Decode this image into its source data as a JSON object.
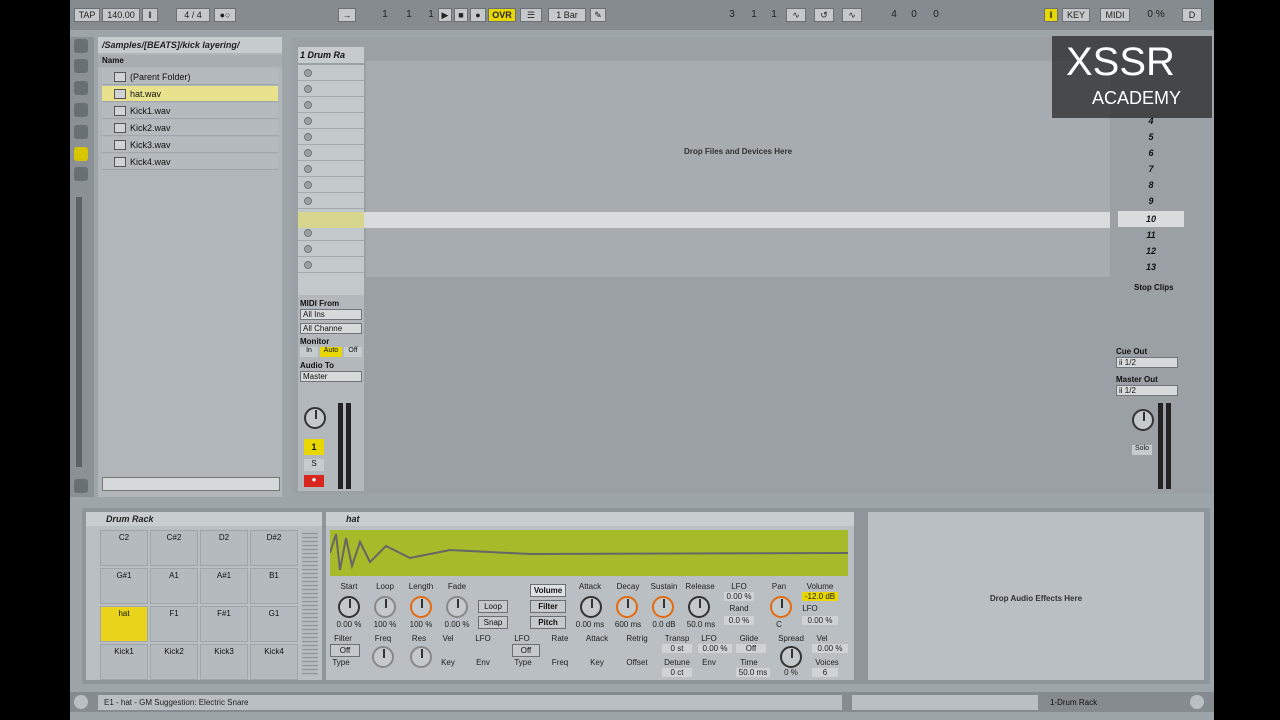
{
  "topbar": {
    "tap": "TAP",
    "tempo": "140.00",
    "signature": "4 / 4",
    "pos1": "1",
    "pos2": "1",
    "pos3": "1",
    "ovr": "OVR",
    "quant": "1 Bar",
    "loop1": "3",
    "loop2": "1",
    "loop3": "1",
    "len1": "4",
    "len2": "0",
    "len3": "0",
    "key": "KEY",
    "midi": "MIDI",
    "cpu": "0 %",
    "d": "D"
  },
  "browser": {
    "path": "/Samples/[BEATS]/kick layering/",
    "column": "Name",
    "items": [
      "(Parent Folder)",
      "hat.wav",
      "Kick1.wav",
      "Kick2.wav",
      "Kick3.wav",
      "Kick4.wav"
    ]
  },
  "session": {
    "track_title": "1 Drum Ra",
    "drop_text": "Drop Files and Devices Here",
    "scenes": [
      "4",
      "5",
      "6",
      "7",
      "8",
      "9",
      "10",
      "11",
      "12",
      "13"
    ],
    "stop_clips": "Stop Clips",
    "cue_out": "Cue Out",
    "cue_val": "ii 1/2",
    "master_out": "Master Out",
    "master_val": "ii 1/2",
    "solo": "Solo"
  },
  "mixer": {
    "midi_from": "MIDI From",
    "all_ins": "All Ins",
    "all_channels": "All Channe",
    "monitor": "Monitor",
    "mon_in": "In",
    "mon_auto": "Auto",
    "mon_off": "Off",
    "audio_to": "Audio To",
    "master": "Master",
    "track_num": "1",
    "s": "S"
  },
  "drum_rack": {
    "title": "Drum Rack",
    "pads": [
      [
        "C2",
        "C#2",
        "D2",
        "D#2"
      ],
      [
        "G#1",
        "A1",
        "A#1",
        "B1"
      ],
      [
        "hat",
        "F1",
        "F#1",
        "G1"
      ],
      [
        "Kick1",
        "Kick2",
        "Kick3",
        "Kick4"
      ]
    ]
  },
  "simpler": {
    "title": "hat",
    "top_labels": [
      "Start",
      "Loop",
      "Length",
      "Fade"
    ],
    "top_values": [
      "0.00 %",
      "100 %",
      "100 %",
      "0.00 %"
    ],
    "loop": "Loop",
    "snap": "Snap",
    "volume": "Volume",
    "filter": "Filter",
    "pitch": "Pitch",
    "env_labels": [
      "Attack",
      "Decay",
      "Sustain",
      "Release"
    ],
    "env_values": [
      "0.00 ms",
      "600 ms",
      "0.0 dB",
      "50.0 ms"
    ],
    "lfo": "LFO",
    "lfo_val": "0.00 %",
    "rand": "Rand",
    "rand_val": "0.0 %",
    "pan": "Pan",
    "pan_val": "C",
    "vol": "Volume",
    "vol_val": "-12.0 dB",
    "vol_lfo": "LFO",
    "vol_lfo_val": "0.00 %",
    "bottom_labels": [
      "Filter",
      "Freq",
      "Res",
      "Vel",
      "LFO",
      "LFO",
      "Rate",
      "Attack",
      "Retrig",
      "Transp",
      "LFO",
      "Glide",
      "Spread",
      "Vel"
    ],
    "bottom2": [
      "Type",
      "Key",
      "Env",
      "Type",
      "Freq",
      "Key",
      "Offset",
      "Detune",
      "Env",
      "Time",
      "Voices"
    ],
    "off": "Off",
    "st": "0 st",
    "zero_pct": "0.00 %",
    "glide_off": "Off",
    "ct": "0 ct",
    "time": "50.0 ms",
    "spread_val": "0 %",
    "vel_val": "0.00 %",
    "voices_val": "6"
  },
  "audio_effects": {
    "drop_text": "Drop Audio Effects Here"
  },
  "status": {
    "text": "E1 - hat - GM Suggestion: Electric Snare",
    "track": "1-Drum Rack"
  },
  "logo": {
    "brand": "XSSR",
    "sub": "ACADEMY"
  }
}
